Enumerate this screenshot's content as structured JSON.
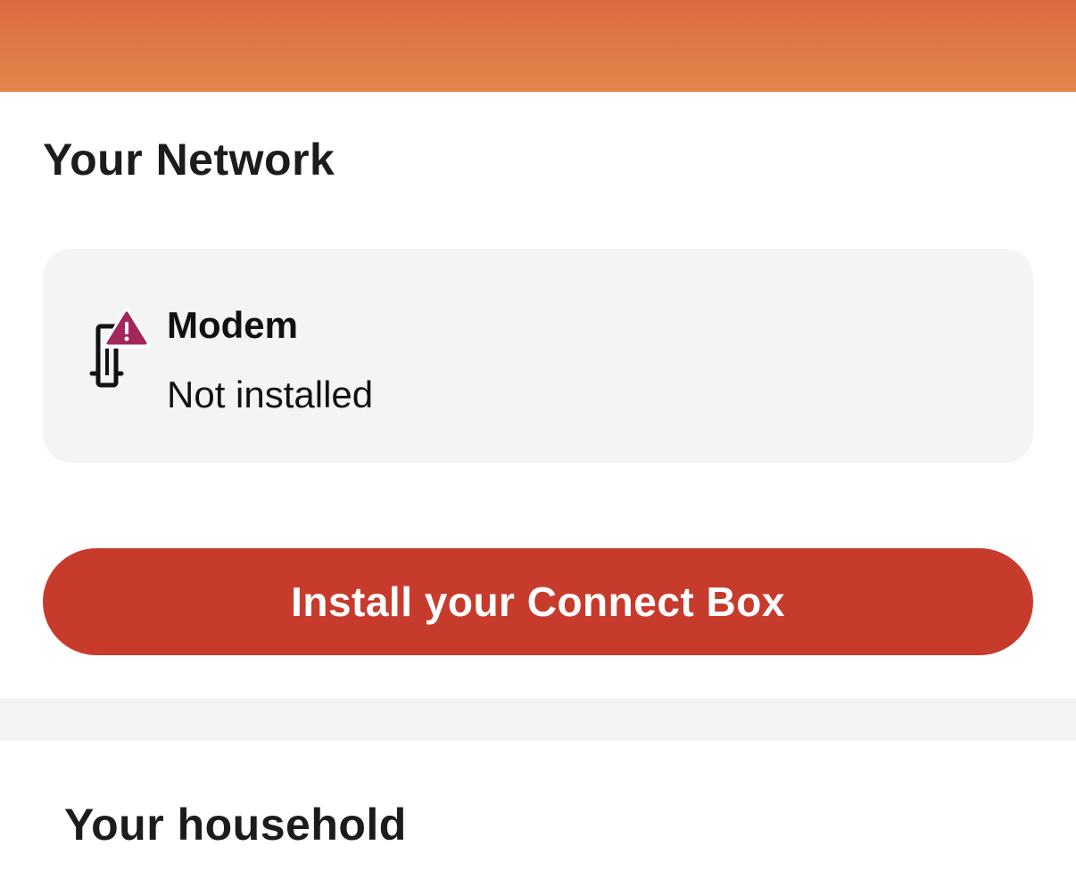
{
  "colors": {
    "banner_top": "#dc6a40",
    "banner_bottom": "#e3854b",
    "primary_button": "#c73b2c",
    "card_background": "#f4f4f4",
    "warning_badge": "#a3265c"
  },
  "network": {
    "title": "Your Network",
    "modem": {
      "icon": "modem-icon",
      "warning_icon": "warning-triangle-icon",
      "name": "Modem",
      "status": "Not installed"
    },
    "install_button_label": "Install your Connect Box"
  },
  "household": {
    "title": "Your household"
  }
}
